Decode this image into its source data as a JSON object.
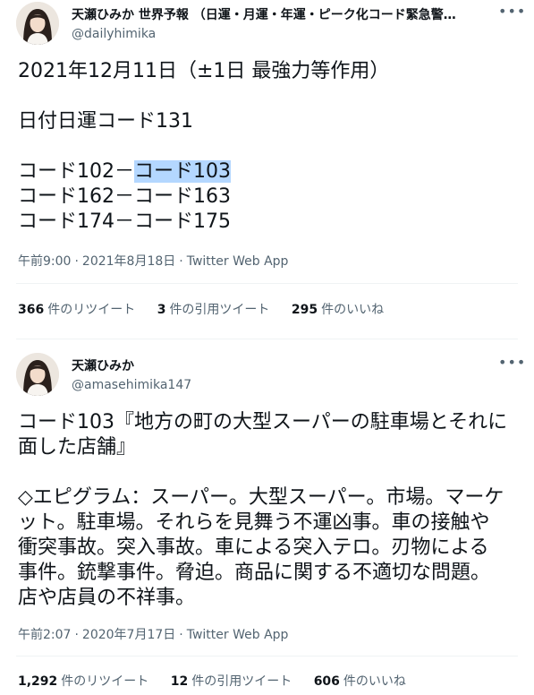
{
  "tweets": [
    {
      "display_name": "天瀬ひみか 世界予報 （日運・月運・年運・ピーク化コード緊急警…",
      "handle": "@dailyhimika",
      "body": {
        "l1": "2021年12月11日（±1日 最強力等作用）",
        "l2": "日付日運コード131",
        "l3a": "コード102－",
        "l3b": "コード103",
        "l4": "コード162－コード163",
        "l5": "コード174－コード175"
      },
      "time": "午前9:00",
      "date": "2021年8月18日",
      "source": "Twitter Web App",
      "stats": {
        "retweets_count": "366",
        "retweets_label": "件のリツイート",
        "quotes_count": "3",
        "quotes_label": "件の引用ツイート",
        "likes_count": "295",
        "likes_label": "件のいいね"
      },
      "more_icon": "more-horizontal-icon"
    },
    {
      "display_name": "天瀬ひみか",
      "handle": "@amasehimika147",
      "body": {
        "l1": "コード103『地方の町の大型スーパーの駐車場とそれに",
        "l2": "面した店舗』",
        "l3": "◇エピグラム：スーパー。大型スーパー。市場。マーケ",
        "l4": "ット。駐車場。それらを見舞う不運凶事。車の接触や",
        "l5": "衝突事故。突入事故。車による突入テロ。刃物による",
        "l6": "事件。銃撃事件。脅迫。商品に関する不適切な問題。",
        "l7": "店や店員の不祥事。"
      },
      "time": "午前2:07",
      "date": "2020年7月17日",
      "source": "Twitter Web App",
      "stats": {
        "retweets_count": "1,292",
        "retweets_label": "件のリツイート",
        "quotes_count": "12",
        "quotes_label": "件の引用ツイート",
        "likes_count": "606",
        "likes_label": "件のいいね"
      },
      "more_icon": "more-horizontal-icon"
    }
  ],
  "separator": "·",
  "colors": {
    "text": "#0f1419",
    "secondary": "#536471",
    "divider": "#eff3f4",
    "selection": "#b4d7ff"
  }
}
